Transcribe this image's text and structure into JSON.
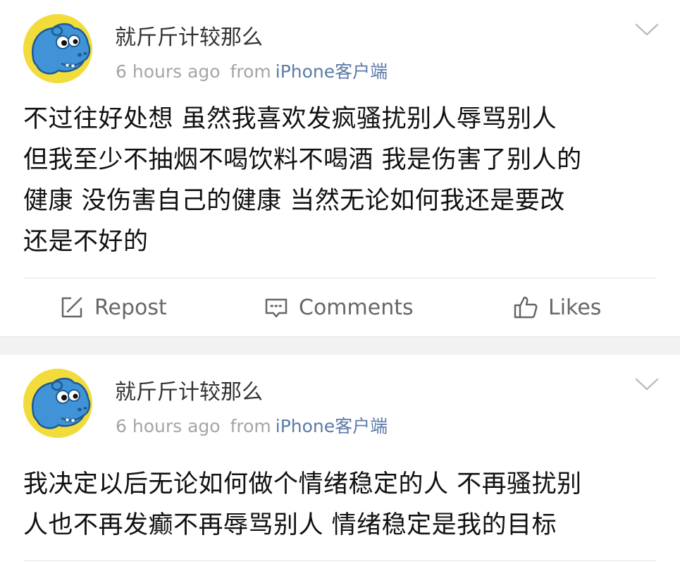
{
  "posts": [
    {
      "username": "就斤斤计较那么",
      "time": "6 hours ago",
      "from_label": "from",
      "source": "iPhone客户端",
      "content_lines": [
        "不过往好处想 虽然我喜欢发疯骚扰别人辱骂别人",
        "但我至少不抽烟不喝饮料不喝酒 我是伤害了别人的",
        "健康 没伤害自己的健康 当然无论如何我还是要改",
        "还是不好的"
      ],
      "actions": {
        "repost": "Repost",
        "comments": "Comments",
        "likes": "Likes"
      }
    },
    {
      "username": "就斤斤计较那么",
      "time": "6 hours ago",
      "from_label": "from",
      "source": "iPhone客户端",
      "content_lines": [
        "我决定以后无论如何做个情绪稳定的人 不再骚扰别",
        "人也不再发癫不再辱骂别人 情绪稳定是我的目标"
      ]
    }
  ],
  "colors": {
    "username": "#333333",
    "meta": "#a5a5a5",
    "source_link": "#5b7ba8",
    "content": "#111111",
    "action": "#666666",
    "separator": "#f2f2f2",
    "avatar_bg": "#f2dc3c",
    "avatar_figure": "#3f93d6"
  },
  "icons": {
    "avatar": "blue-hippo-avatar",
    "chevron": "chevron-down-icon",
    "repost": "repost-icon",
    "comments": "comments-icon",
    "likes": "thumbs-up-icon"
  }
}
